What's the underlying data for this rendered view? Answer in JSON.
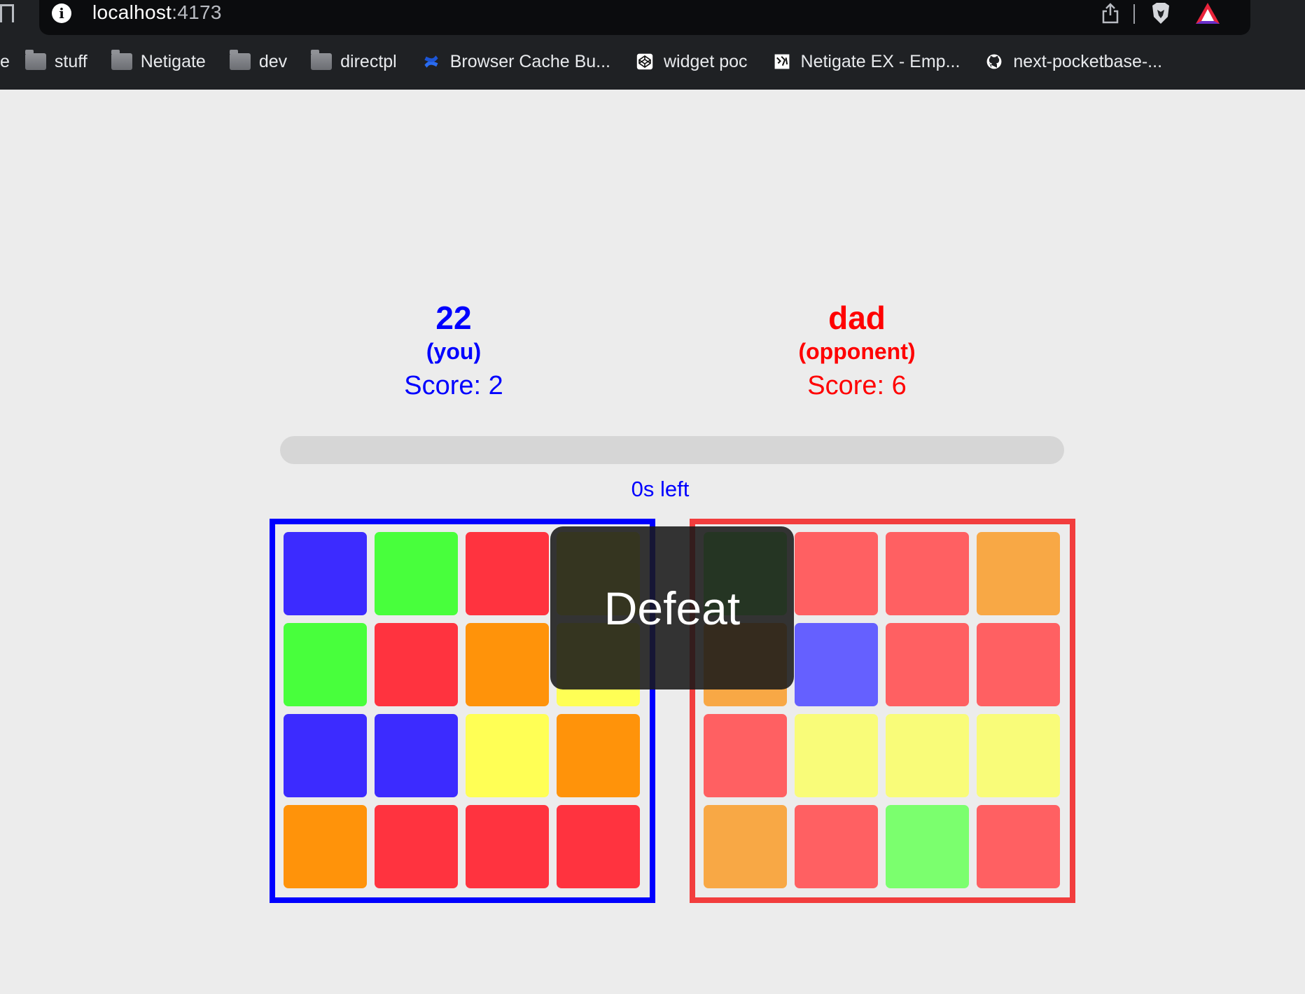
{
  "browser": {
    "url_host": "localhost",
    "url_port": ":4173",
    "bookmarks": [
      {
        "label": "e",
        "icon": "folder-icon"
      },
      {
        "label": "stuff",
        "icon": "folder-icon"
      },
      {
        "label": "Netigate",
        "icon": "folder-icon"
      },
      {
        "label": "dev",
        "icon": "folder-icon"
      },
      {
        "label": "directpl",
        "icon": "folder-icon"
      },
      {
        "label": "Browser Cache Bu...",
        "icon": "confluence-icon"
      },
      {
        "label": "widget poc",
        "icon": "codepen-icon"
      },
      {
        "label": "Netigate EX - Emp...",
        "icon": "netigate-icon"
      },
      {
        "label": "next-pocketbase-...",
        "icon": "github-icon"
      }
    ]
  },
  "game": {
    "you": {
      "name": "22",
      "role": "(you)",
      "score": "Score: 2",
      "color": "#0000ff"
    },
    "opponent": {
      "name": "dad",
      "role": "(opponent)",
      "score": "Score: 6",
      "color": "#ff0000"
    },
    "timer": {
      "label": "0s left",
      "progress": 0
    },
    "result": "Defeat",
    "board_you": [
      "#3c2bff",
      "#48ff3c",
      "#ff333f",
      "#ffff55",
      "#48ff3c",
      "#ff333f",
      "#ff930a",
      "#ffff55",
      "#3c2bff",
      "#3c2bff",
      "#ffff55",
      "#ff930a",
      "#ff930a",
      "#ff333f",
      "#ff333f",
      "#ff333f"
    ],
    "board_opponent": [
      "#7bff6e",
      "#ff6062",
      "#ff6062",
      "#f8a845",
      "#f8a845",
      "#6560ff",
      "#ff6062",
      "#ff6062",
      "#ff6062",
      "#f9fc79",
      "#f9fc79",
      "#f9fc79",
      "#f8a845",
      "#ff6062",
      "#7bff6e",
      "#ff6062"
    ]
  }
}
